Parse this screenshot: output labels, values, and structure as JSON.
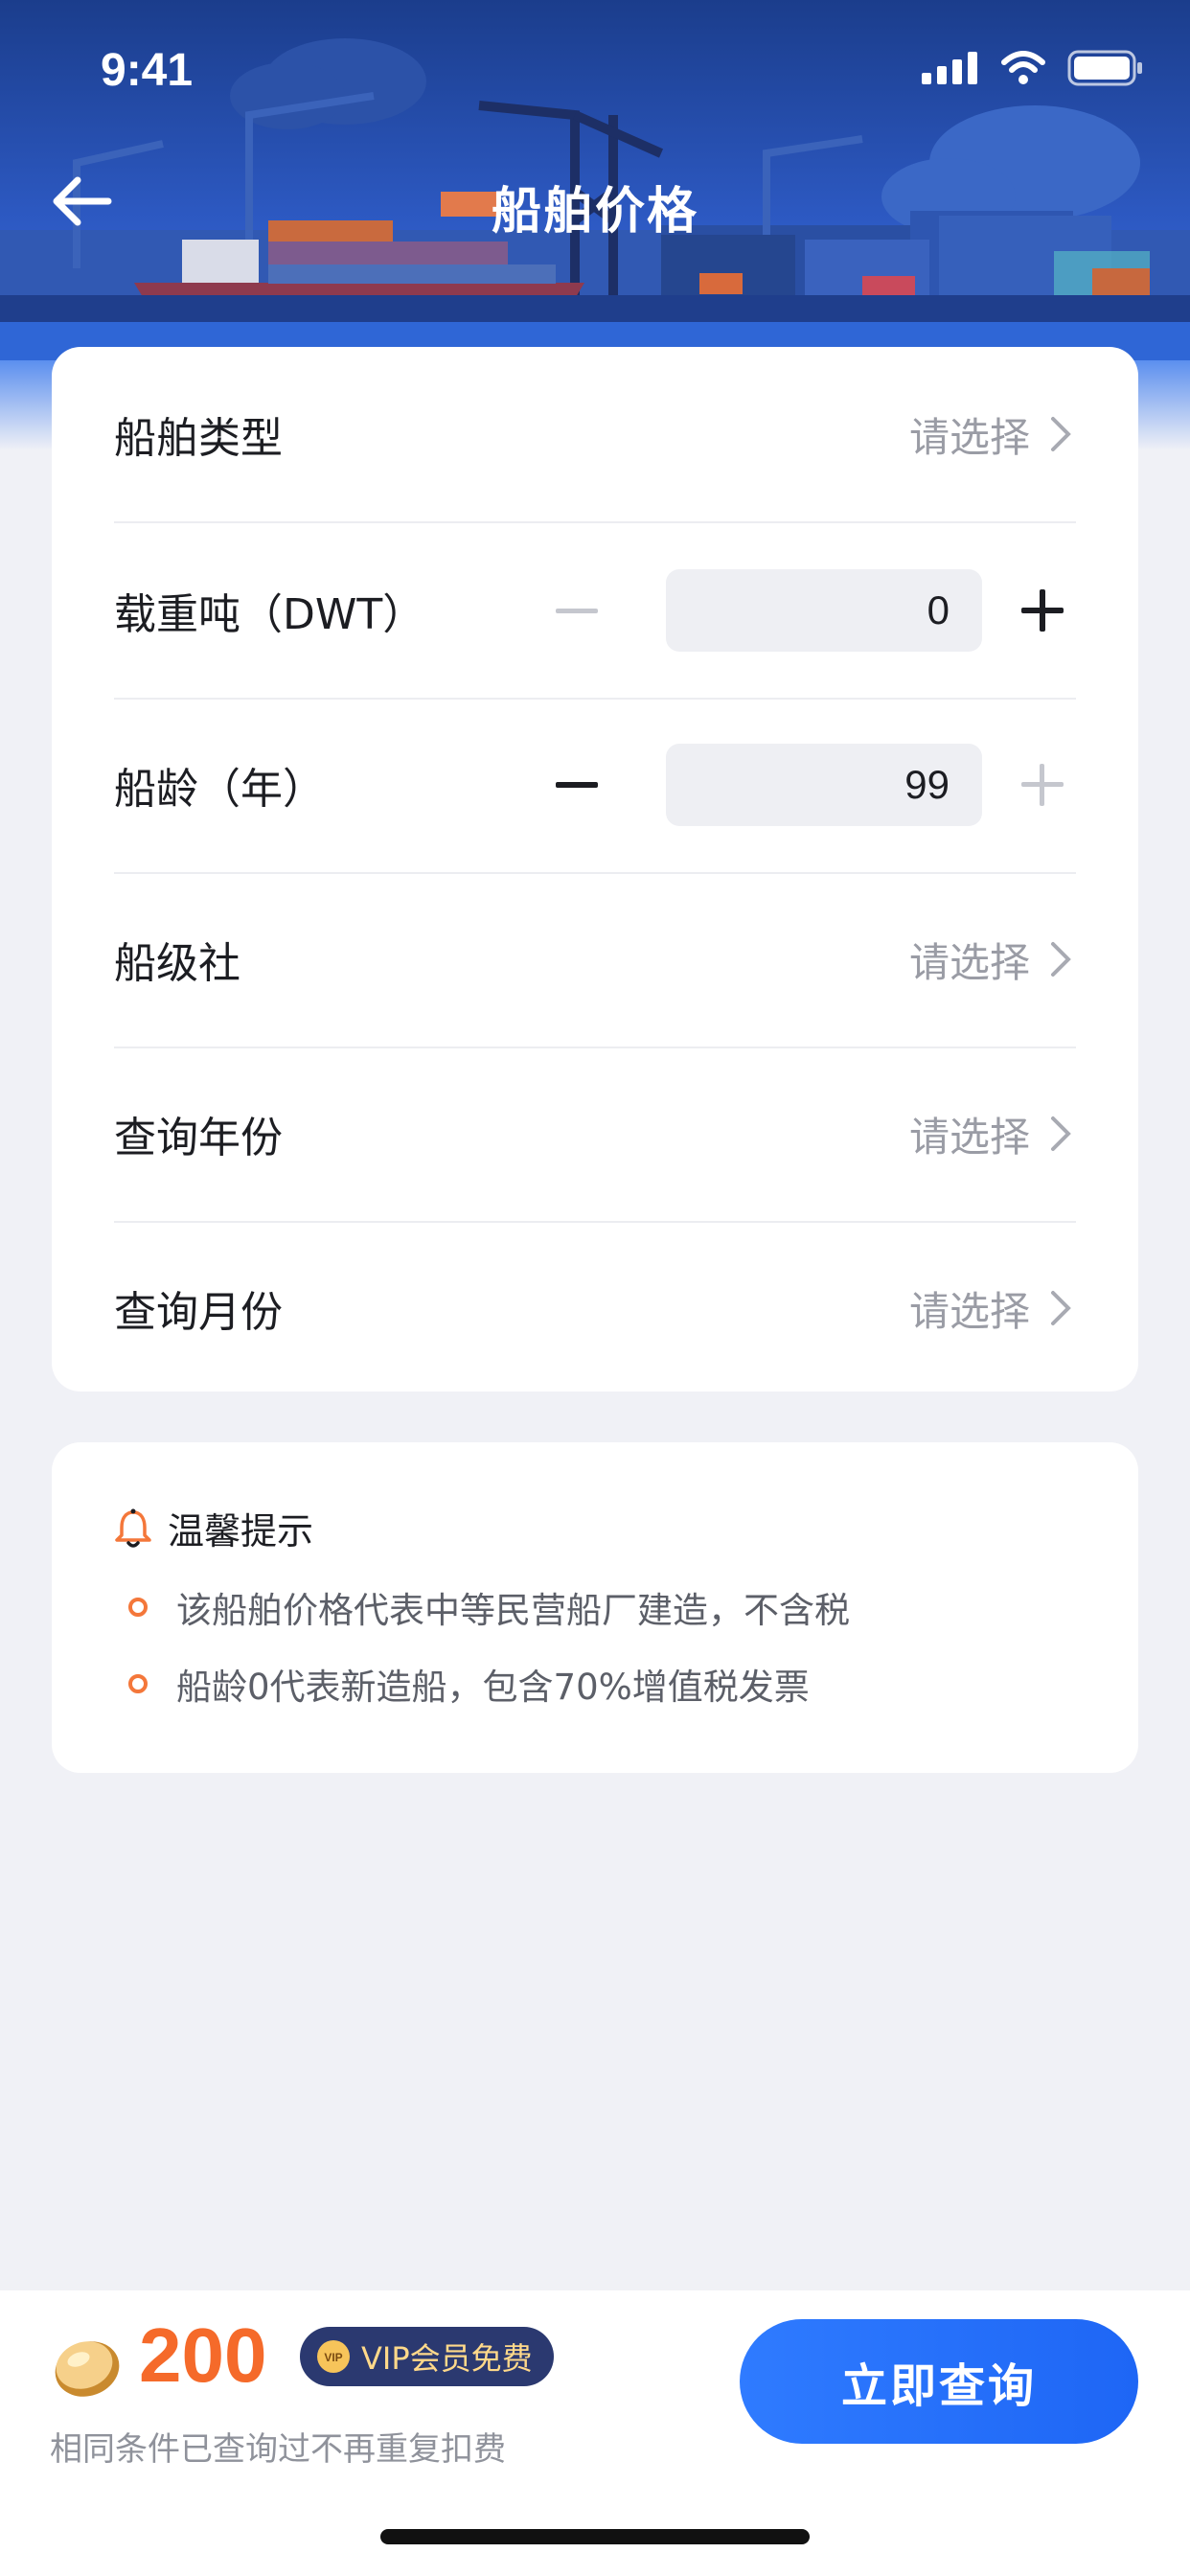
{
  "status_bar": {
    "time": "9:41"
  },
  "nav": {
    "title": "船舶价格"
  },
  "form": {
    "ship_type": {
      "label": "船舶类型",
      "value": "请选择"
    },
    "dwt": {
      "label": "载重吨（DWT）",
      "value": "0"
    },
    "age": {
      "label": "船龄（年）",
      "value": "99"
    },
    "class_society": {
      "label": "船级社",
      "value": "请选择"
    },
    "query_year": {
      "label": "查询年份",
      "value": "请选择"
    },
    "query_month": {
      "label": "查询月份",
      "value": "请选择"
    }
  },
  "tips": {
    "title": "温馨提示",
    "items": [
      "该船舶价格代表中等民营船厂建造，不含税",
      "船龄0代表新造船，包含70%增值税发票"
    ]
  },
  "footer": {
    "points": "200",
    "vip_label": "VIP会员免费",
    "note": "相同条件已查询过不再重复扣费",
    "query_button": "立即查询"
  },
  "colors": {
    "accent": "#1E66F5",
    "points": "#F56A2A",
    "tip_dot": "#F4773A",
    "vip_bg": "#2B3970"
  },
  "icons": [
    "back-arrow-icon",
    "chevron-right-icon",
    "minus-icon",
    "plus-icon",
    "bell-icon",
    "coin-icon",
    "vip-icon",
    "signal-icon",
    "wifi-icon",
    "battery-icon"
  ]
}
